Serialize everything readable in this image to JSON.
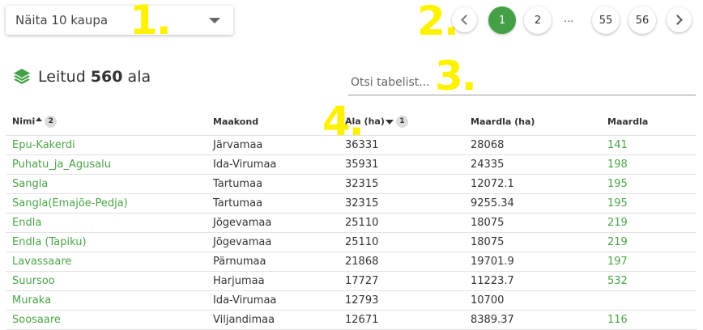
{
  "page_size_select": {
    "value": "Näita 10 kaupa",
    "icon": "caret-down-icon"
  },
  "annotations": [
    "1.",
    "2.",
    "3.",
    "4."
  ],
  "pagination": {
    "pages": [
      "1",
      "2",
      "...",
      "55",
      "56"
    ],
    "active": "1",
    "prev_icon": "chevron-left-icon",
    "next_icon": "chevron-right-icon",
    "active_color": "#43a047"
  },
  "summary": {
    "prefix": "Leitud",
    "count": "560",
    "suffix": "ala",
    "icon": "layers-icon"
  },
  "search": {
    "placeholder": "Otsi tabelist..."
  },
  "table": {
    "headers": {
      "name": "Nimi",
      "name_sort_order": "2",
      "county": "Maakond",
      "area": "Ala (ha)",
      "area_sort_order": "1",
      "peat_area": "Maardla (ha)",
      "peat_deposit": "Maardla"
    },
    "rows": [
      {
        "name": "Epu-Kakerdi",
        "county": "Järvamaa",
        "area": "36331",
        "peat_area": "28068",
        "peat_deposit": "141"
      },
      {
        "name": "Puhatu_ja_Agusalu",
        "county": "Ida-Virumaa",
        "area": "35931",
        "peat_area": "24335",
        "peat_deposit": "198"
      },
      {
        "name": "Sangla",
        "county": "Tartumaa",
        "area": "32315",
        "peat_area": "12072.1",
        "peat_deposit": "195"
      },
      {
        "name": "Sangla(Emajõe-Pedja)",
        "county": "Tartumaa",
        "area": "32315",
        "peat_area": "9255.34",
        "peat_deposit": "195"
      },
      {
        "name": "Endla",
        "county": "Jõgevamaa",
        "area": "25110",
        "peat_area": "18075",
        "peat_deposit": "219"
      },
      {
        "name": "Endla (Tapiku)",
        "county": "Jõgevamaa",
        "area": "25110",
        "peat_area": "18075",
        "peat_deposit": "219"
      },
      {
        "name": "Lavassaare",
        "county": "Pärnumaa",
        "area": "21868",
        "peat_area": "19701.9",
        "peat_deposit": "197"
      },
      {
        "name": "Suursoo",
        "county": "Harjumaa",
        "area": "17727",
        "peat_area": "11223.7",
        "peat_deposit": "532"
      },
      {
        "name": "Muraka",
        "county": "Ida-Virumaa",
        "area": "12793",
        "peat_area": "10700",
        "peat_deposit": ""
      },
      {
        "name": "Soosaare",
        "county": "Viljandimaa",
        "area": "12671",
        "peat_area": "8389.37",
        "peat_deposit": "116"
      }
    ]
  },
  "colors": {
    "link_green": "#4aa546",
    "annotation_yellow": "#fff200"
  }
}
